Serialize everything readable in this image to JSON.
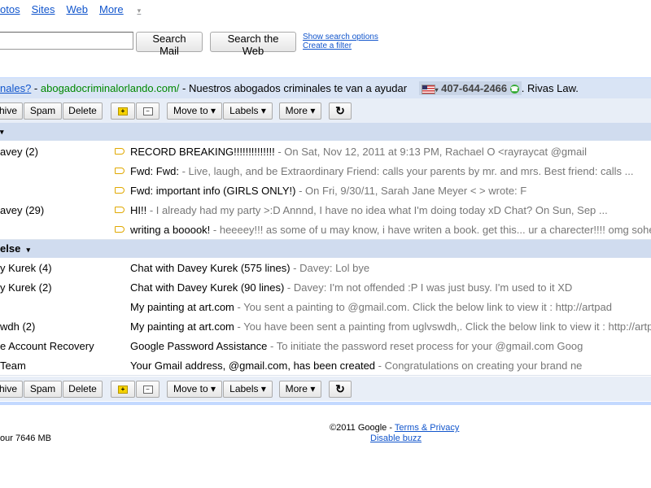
{
  "topnav": {
    "items": [
      "otos",
      "Sites",
      "Web"
    ],
    "more": "More"
  },
  "search": {
    "search_mail": "Search Mail",
    "search_web": "Search the Web",
    "show_options": "Show search options",
    "create_filter": "Create a filter"
  },
  "ad": {
    "link": "nales?",
    "url": "abogadocriminalorlando.com/",
    "text": " - Nuestros abogados criminales te van a ayudar",
    "phone": "407-644-2466",
    "after": ". Rivas Law."
  },
  "toolbar": {
    "archive": "hive",
    "spam": "Spam",
    "delete": "Delete",
    "move_to": "Move to ▾",
    "labels": "Labels ▾",
    "more": "More ▾"
  },
  "sections": {
    "first_caret": "▾",
    "everything_else": "else"
  },
  "rows_top": [
    {
      "sender": "avey (2)",
      "subject": "RECORD BREAKING!!!!!!!!!!!!!!",
      "snippet": " - On Sat, Nov 12, 2011 at 9:13 PM, Rachael O                  <rayraycat          @gmail",
      "label": true
    },
    {
      "sender": "",
      "subject": "Fwd: Fwd:",
      "snippet": " - Live, laugh, and be Extraordinary Friend: calls your parents by mr. and mrs. Best friend: calls ...",
      "label": true
    },
    {
      "sender": "",
      "subject": "Fwd: important info (GIRLS ONLY!)",
      "snippet": " - On Fri, 9/30/11, Sarah Jane Meyer <                                        > wrote: F",
      "label": true
    },
    {
      "sender": "avey (29)",
      "subject": "HI!!",
      "snippet": " - I already had my party >:D Annnd, I have no idea what I'm doing today xD Chat? On Sun, Sep ...",
      "label": true
    },
    {
      "sender": "",
      "subject": "writing a booook!",
      "snippet": " - heeeey!!! as some of u may know, i have writen a book. get this... ur a charecter!!!! omg soheres",
      "label": true
    }
  ],
  "rows_else": [
    {
      "sender": "y Kurek (4)",
      "subject": "Chat with Davey Kurek (575 lines)",
      "snippet": " - Davey: Lol bye"
    },
    {
      "sender": "y Kurek (2)",
      "subject": "Chat with Davey Kurek (90 lines)",
      "snippet": " - Davey: I'm not offended :P I was just busy. I'm used to it XD"
    },
    {
      "sender": "",
      "subject": "My painting at art.com",
      "snippet": " - You sent a painting to                    @gmail.com. Click the below link to view it : http://artpad"
    },
    {
      "sender": "wdh (2)",
      "subject": "My painting at art.com",
      "snippet": " - You have been sent a painting from uglvswdh,. Click the below link to view it : http://artpad.a"
    },
    {
      "sender": "e Account Recovery",
      "subject": "Google Password Assistance",
      "snippet": " - To initiate the password reset process for your                          @gmail.com Goog"
    },
    {
      "sender": " Team",
      "subject": "Your Gmail address,                    @gmail.com, has been created",
      "snippet": " - Congratulations on creating your brand ne"
    }
  ],
  "footer": {
    "storage": "our 7646 MB",
    "copyright": "©2011 Google - ",
    "terms": "Terms & Privacy",
    "buzz": "Disable buzz"
  },
  "colors": {
    "accent_bg": "#e8eef7",
    "section_bg": "#d0dcef",
    "link": "#1155cc"
  }
}
